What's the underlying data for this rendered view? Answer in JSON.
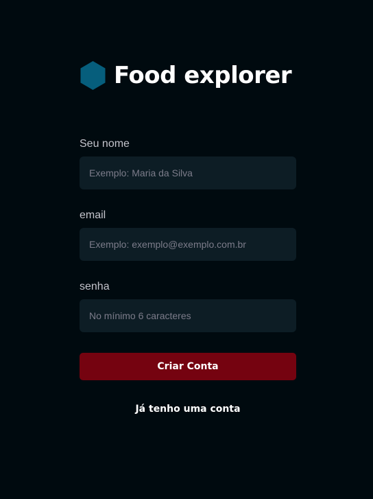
{
  "brand": {
    "name": "Food explorer",
    "logo_icon": "hexagon-icon",
    "logo_color": "#065E7C"
  },
  "form": {
    "fields": [
      {
        "label": "Seu nome",
        "placeholder": "Exemplo: Maria da Silva",
        "value": ""
      },
      {
        "label": "email",
        "placeholder": "Exemplo: exemplo@exemplo.com.br",
        "value": ""
      },
      {
        "label": "senha",
        "placeholder": "No mínimo 6 caracteres",
        "value": ""
      }
    ],
    "submit_label": "Criar Conta",
    "login_link_label": "Já tenho uma conta"
  },
  "colors": {
    "background": "#000A0F",
    "input_background": "#0D1D25",
    "button": "#750310",
    "label": "#C4C4CC",
    "placeholder": "#7C7C8A"
  }
}
